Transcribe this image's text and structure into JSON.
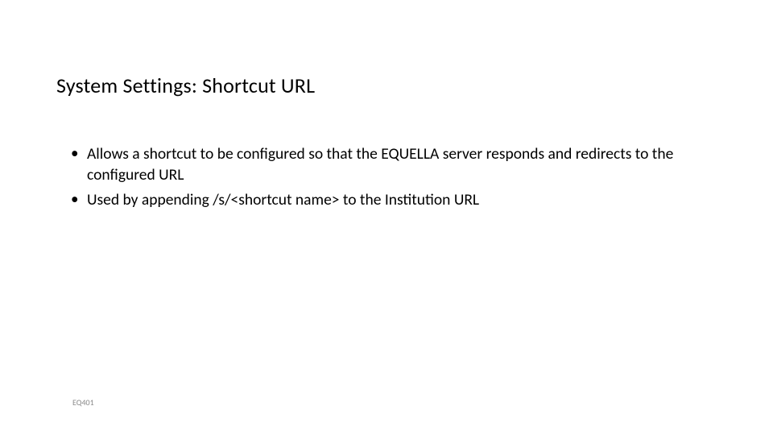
{
  "title": "System Settings: Shortcut URL",
  "bullets": [
    "Allows a shortcut to be configured so that the EQUELLA server responds and redirects to the configured URL",
    "Used by appending /s/<shortcut name> to the Institution URL"
  ],
  "footer": "EQ401"
}
